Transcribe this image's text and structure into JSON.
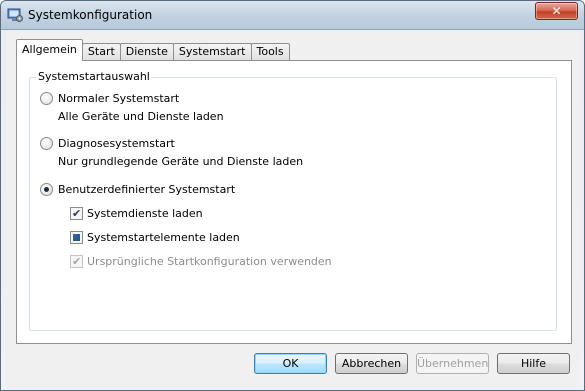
{
  "window": {
    "title": "Systemkonfiguration",
    "close_label": "✕"
  },
  "tabs": [
    {
      "label": "Allgemein",
      "active": true
    },
    {
      "label": "Start"
    },
    {
      "label": "Dienste"
    },
    {
      "label": "Systemstart"
    },
    {
      "label": "Tools"
    }
  ],
  "group": {
    "legend": "Systemstartauswahl",
    "options": [
      {
        "label": "Normaler Systemstart",
        "description": "Alle Geräte und Dienste laden",
        "checked": false
      },
      {
        "label": "Diagnosesystemstart",
        "description": "Nur grundlegende Geräte und Dienste laden",
        "checked": false
      },
      {
        "label": "Benutzerdefinierter Systemstart",
        "checked": true
      }
    ],
    "checkboxes": [
      {
        "label": "Systemdienste laden",
        "state": "checked"
      },
      {
        "label": "Systemstartelemente laden",
        "state": "indeterminate"
      },
      {
        "label": "Ursprüngliche Startkonfiguration verwenden",
        "state": "checked-disabled"
      }
    ]
  },
  "buttons": {
    "ok": "OK",
    "cancel": "Abbrechen",
    "apply": "Übernehmen",
    "help": "Hilfe"
  }
}
